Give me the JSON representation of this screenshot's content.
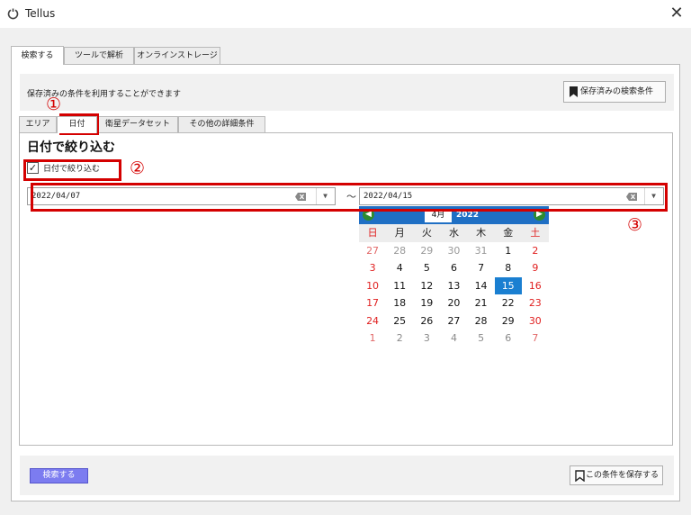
{
  "window": {
    "title": "Tellus",
    "close_symbol": "✕"
  },
  "main_tabs": [
    {
      "label": "検索する",
      "active": true
    },
    {
      "label": "ツールで解析",
      "active": false
    },
    {
      "label": "オンラインストレージ",
      "active": false
    }
  ],
  "saved_conditions": {
    "description": "保存済みの条件を利用することができます",
    "button_label": "保存済みの検索条件"
  },
  "sub_tabs": [
    {
      "label": "エリア",
      "active": false
    },
    {
      "label": "日付",
      "active": true
    },
    {
      "label": "衛星データセット",
      "active": false
    },
    {
      "label": "その他の詳細条件",
      "active": false
    }
  ],
  "date_filter": {
    "section_title": "日付で絞り込む",
    "checkbox_label": "日付で絞り込む",
    "checkbox_checked": true,
    "checkbox_mark": "✓",
    "start_date": "2022/04/07",
    "end_date": "2022/04/15",
    "range_separator": "〜"
  },
  "annotations": {
    "marker_1": "①",
    "marker_2": "②",
    "marker_3": "③"
  },
  "calendar": {
    "month_label": "4月",
    "year_label": "2022",
    "prev_symbol": "◀",
    "next_symbol": "▶",
    "weekdays": [
      "日",
      "月",
      "火",
      "水",
      "木",
      "金",
      "土"
    ],
    "weeks": [
      [
        "27",
        "28",
        "29",
        "30",
        "31",
        "1",
        "2"
      ],
      [
        "3",
        "4",
        "5",
        "6",
        "7",
        "8",
        "9"
      ],
      [
        "10",
        "11",
        "12",
        "13",
        "14",
        "15",
        "16"
      ],
      [
        "17",
        "18",
        "19",
        "20",
        "21",
        "22",
        "23"
      ],
      [
        "24",
        "25",
        "26",
        "27",
        "28",
        "29",
        "30"
      ],
      [
        "1",
        "2",
        "3",
        "4",
        "5",
        "6",
        "7"
      ]
    ],
    "selected_day": "15"
  },
  "bottom": {
    "search_button": "検索する",
    "save_condition_button": "この条件を保存する"
  },
  "colors": {
    "annotation_red": "#d40000",
    "calendar_header": "#1f6fc4",
    "selected_day": "#1a7fd1",
    "search_button": "#7c7cf0"
  }
}
